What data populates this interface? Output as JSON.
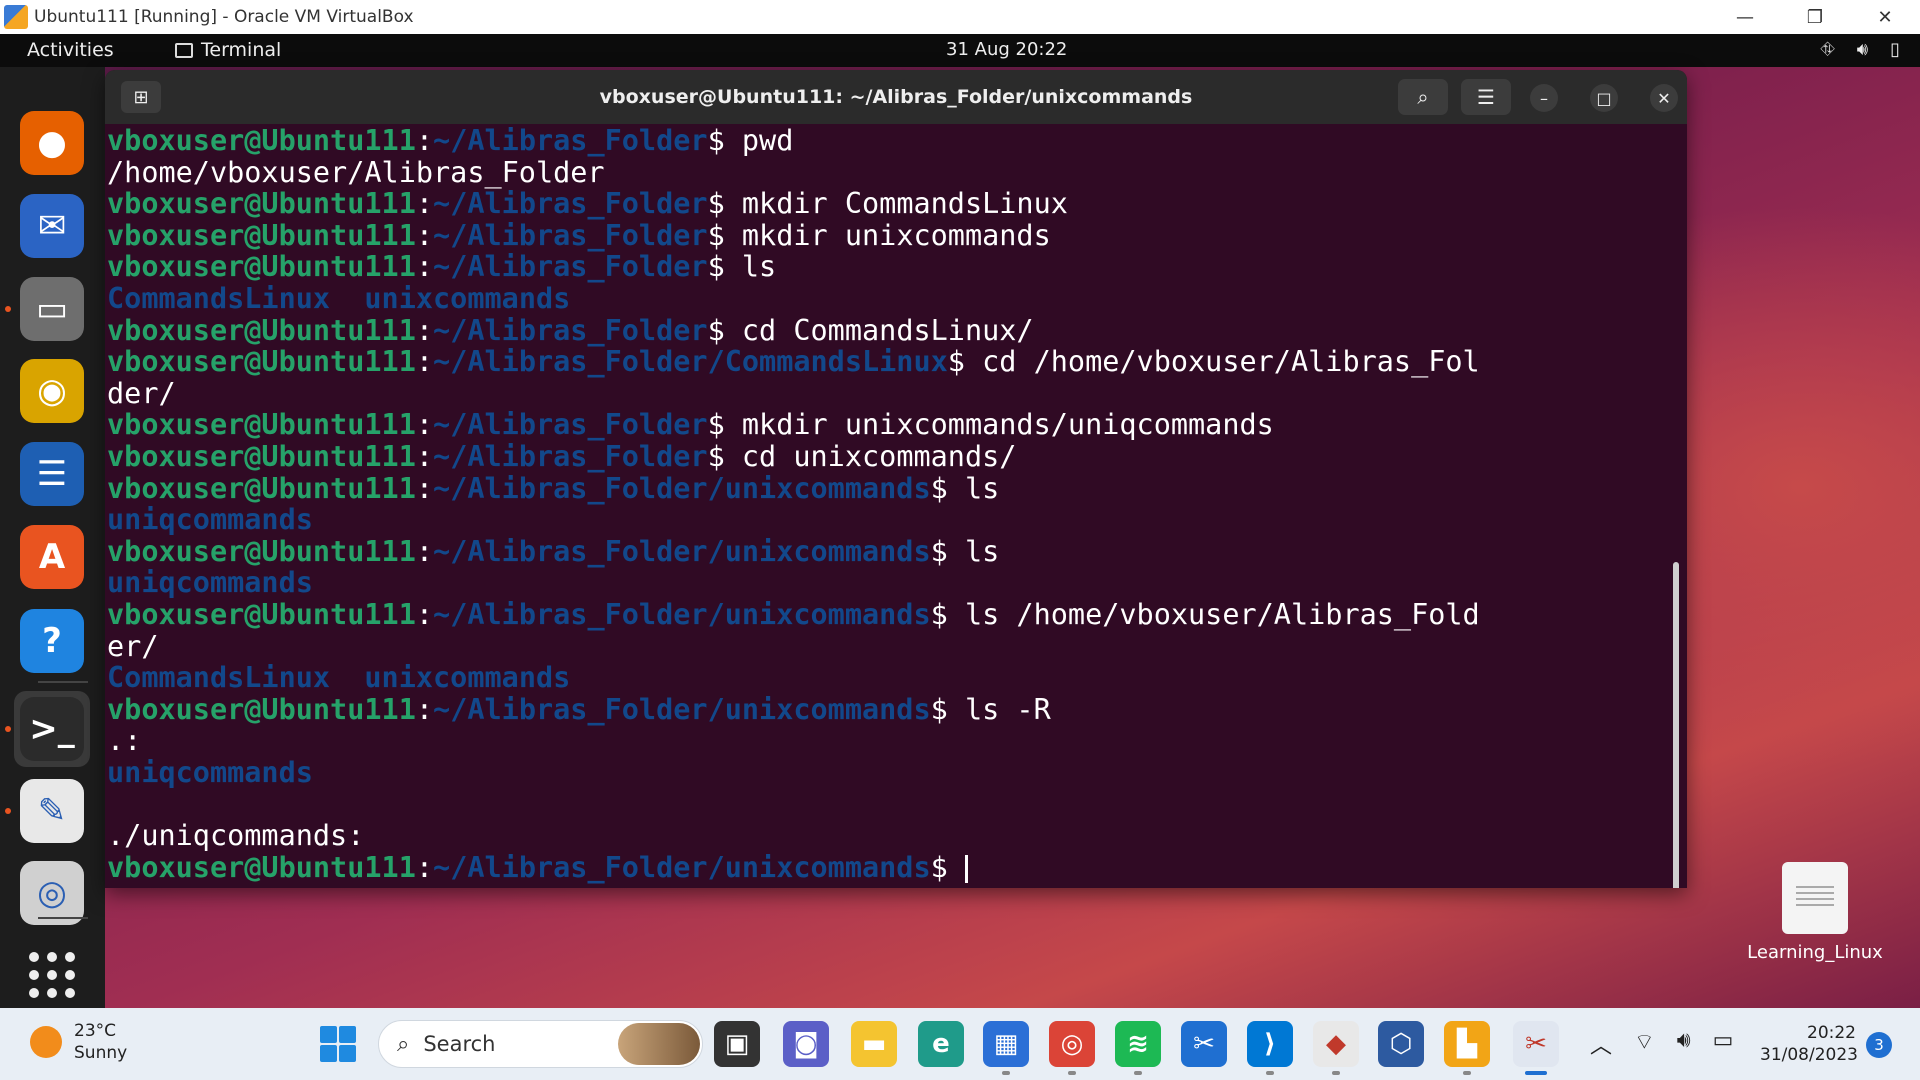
{
  "host_window": {
    "title": "Ubuntu111 [Running] - Oracle VM VirtualBox",
    "controls": [
      "—",
      "❐",
      "✕"
    ]
  },
  "top_bar": {
    "activities": "Activities",
    "app_name": "Terminal",
    "clock": "31 Aug  20:22",
    "status_icons": [
      "network-icon",
      "volume-icon",
      "battery-icon"
    ]
  },
  "dock": {
    "items": [
      {
        "name": "firefox",
        "icon": "firefox-icon",
        "color": "#e66000",
        "glyph": "●",
        "running": false
      },
      {
        "name": "thunderbird",
        "icon": "thunderbird-icon",
        "color": "#2b64c4",
        "glyph": "✉",
        "running": false
      },
      {
        "name": "files",
        "icon": "files-icon",
        "color": "#6e6e6e",
        "glyph": "▭",
        "running": true
      },
      {
        "name": "rhythmbox",
        "icon": "rhythmbox-icon",
        "color": "#d9a400",
        "glyph": "◉",
        "running": false
      },
      {
        "name": "libreoffice-writer",
        "icon": "writer-icon",
        "color": "#1e5fb3",
        "glyph": "☰",
        "running": false
      },
      {
        "name": "app-center",
        "icon": "app-center-icon",
        "color": "#e95420",
        "glyph": "A",
        "running": false
      },
      {
        "name": "help",
        "icon": "help-icon",
        "color": "#1f84e0",
        "glyph": "?",
        "running": false
      },
      {
        "name": "terminal",
        "icon": "terminal-icon",
        "color": "#2b2b2b",
        "glyph": ">_",
        "running": true
      },
      {
        "name": "text-editor",
        "icon": "text-editor-icon",
        "color": "#e8e8e8",
        "glyph": "✎",
        "running": true
      },
      {
        "name": "disc",
        "icon": "disc-icon",
        "color": "#d0d0d0",
        "glyph": "◎",
        "running": false
      }
    ],
    "show_apps_icon": "grid-icon"
  },
  "terminal": {
    "title": "vboxuser@Ubuntu111: ~/Alibras_Folder/unixcommands",
    "lines": [
      [
        {
          "t": "vboxuser@Ubuntu111",
          "c": "u"
        },
        {
          "t": ":",
          "c": ""
        },
        {
          "t": "~/Alibras_Folder",
          "c": "p"
        },
        {
          "t": "$ pwd",
          "c": ""
        }
      ],
      [
        {
          "t": "/home/vboxuser/Alibras_Folder",
          "c": ""
        }
      ],
      [
        {
          "t": "vboxuser@Ubuntu111",
          "c": "u"
        },
        {
          "t": ":",
          "c": ""
        },
        {
          "t": "~/Alibras_Folder",
          "c": "p"
        },
        {
          "t": "$ mkdir CommandsLinux",
          "c": ""
        }
      ],
      [
        {
          "t": "vboxuser@Ubuntu111",
          "c": "u"
        },
        {
          "t": ":",
          "c": ""
        },
        {
          "t": "~/Alibras_Folder",
          "c": "p"
        },
        {
          "t": "$ mkdir unixcommands",
          "c": ""
        }
      ],
      [
        {
          "t": "vboxuser@Ubuntu111",
          "c": "u"
        },
        {
          "t": ":",
          "c": ""
        },
        {
          "t": "~/Alibras_Folder",
          "c": "p"
        },
        {
          "t": "$ ls",
          "c": ""
        }
      ],
      [
        {
          "t": "CommandsLinux",
          "c": "d"
        },
        {
          "t": "  ",
          "c": ""
        },
        {
          "t": "unixcommands",
          "c": "d"
        }
      ],
      [
        {
          "t": "vboxuser@Ubuntu111",
          "c": "u"
        },
        {
          "t": ":",
          "c": ""
        },
        {
          "t": "~/Alibras_Folder",
          "c": "p"
        },
        {
          "t": "$ cd CommandsLinux/",
          "c": ""
        }
      ],
      [
        {
          "t": "vboxuser@Ubuntu111",
          "c": "u"
        },
        {
          "t": ":",
          "c": ""
        },
        {
          "t": "~/Alibras_Folder/CommandsLinux",
          "c": "p"
        },
        {
          "t": "$ cd /home/vboxuser/Alibras_Fol",
          "c": ""
        }
      ],
      [
        {
          "t": "der/",
          "c": ""
        }
      ],
      [
        {
          "t": "vboxuser@Ubuntu111",
          "c": "u"
        },
        {
          "t": ":",
          "c": ""
        },
        {
          "t": "~/Alibras_Folder",
          "c": "p"
        },
        {
          "t": "$ mkdir unixcommands/uniqcommands",
          "c": ""
        }
      ],
      [
        {
          "t": "vboxuser@Ubuntu111",
          "c": "u"
        },
        {
          "t": ":",
          "c": ""
        },
        {
          "t": "~/Alibras_Folder",
          "c": "p"
        },
        {
          "t": "$ cd unixcommands/",
          "c": ""
        }
      ],
      [
        {
          "t": "vboxuser@Ubuntu111",
          "c": "u"
        },
        {
          "t": ":",
          "c": ""
        },
        {
          "t": "~/Alibras_Folder/unixcommands",
          "c": "p"
        },
        {
          "t": "$ ls",
          "c": ""
        }
      ],
      [
        {
          "t": "uniqcommands",
          "c": "d"
        }
      ],
      [
        {
          "t": "vboxuser@Ubuntu111",
          "c": "u"
        },
        {
          "t": ":",
          "c": ""
        },
        {
          "t": "~/Alibras_Folder/unixcommands",
          "c": "p"
        },
        {
          "t": "$ ls",
          "c": ""
        }
      ],
      [
        {
          "t": "uniqcommands",
          "c": "d"
        }
      ],
      [
        {
          "t": "vboxuser@Ubuntu111",
          "c": "u"
        },
        {
          "t": ":",
          "c": ""
        },
        {
          "t": "~/Alibras_Folder/unixcommands",
          "c": "p"
        },
        {
          "t": "$ ls /home/vboxuser/Alibras_Fold",
          "c": ""
        }
      ],
      [
        {
          "t": "er/",
          "c": ""
        }
      ],
      [
        {
          "t": "CommandsLinux",
          "c": "d"
        },
        {
          "t": "  ",
          "c": ""
        },
        {
          "t": "unixcommands",
          "c": "d"
        }
      ],
      [
        {
          "t": "vboxuser@Ubuntu111",
          "c": "u"
        },
        {
          "t": ":",
          "c": ""
        },
        {
          "t": "~/Alibras_Folder/unixcommands",
          "c": "p"
        },
        {
          "t": "$ ls -R",
          "c": ""
        }
      ],
      [
        {
          "t": ".:",
          "c": ""
        }
      ],
      [
        {
          "t": "uniqcommands",
          "c": "d"
        }
      ],
      [
        {
          "t": "",
          "c": ""
        }
      ],
      [
        {
          "t": "./uniqcommands:",
          "c": ""
        }
      ],
      [
        {
          "t": "vboxuser@Ubuntu111",
          "c": "u"
        },
        {
          "t": ":",
          "c": ""
        },
        {
          "t": "~/Alibras_Folder/unixcommands",
          "c": "p"
        },
        {
          "t": "$ ",
          "c": ""
        }
      ]
    ]
  },
  "desktop": {
    "file_label": "Learning_Linux"
  },
  "taskbar": {
    "weather_temp": "23°C",
    "weather_desc": "Sunny",
    "search_placeholder": "Search",
    "time": "20:22",
    "date": "31/08/2023",
    "notification_count": "3",
    "apps": [
      {
        "name": "task-view",
        "icon": "task-view-icon",
        "color": "#333333",
        "glyph": "▣"
      },
      {
        "name": "teams",
        "icon": "teams-chat-icon",
        "color": "#5b5fc7",
        "glyph": "◙"
      },
      {
        "name": "file-explorer",
        "icon": "folder-icon",
        "color": "#f4c430",
        "glyph": "▬"
      },
      {
        "name": "edge",
        "icon": "edge-icon",
        "color": "#1f9b8a",
        "glyph": "e"
      },
      {
        "name": "store",
        "icon": "store-icon",
        "color": "#2b6fd6",
        "glyph": "▦"
      },
      {
        "name": "chrome",
        "icon": "chrome-icon",
        "color": "#db4437",
        "glyph": "◎"
      },
      {
        "name": "spotify",
        "icon": "spotify-icon",
        "color": "#1db954",
        "glyph": "≋"
      },
      {
        "name": "snip",
        "icon": "snip-icon",
        "color": "#1f6fd1",
        "glyph": "✂"
      },
      {
        "name": "vscode",
        "icon": "vscode-icon",
        "color": "#0078d4",
        "glyph": "⟩"
      },
      {
        "name": "git",
        "icon": "git-icon",
        "color": "#e8e8e8",
        "glyph": "◆"
      },
      {
        "name": "virtualbox",
        "icon": "virtualbox-icon",
        "color": "#2d5aa0",
        "glyph": "⬡"
      },
      {
        "name": "vbox-vm",
        "icon": "vbox-vm-icon",
        "color": "#f2a516",
        "glyph": "▙"
      },
      {
        "name": "snipping-tool",
        "icon": "snipping-tool-icon",
        "color": "#e0e6f0",
        "glyph": "✂"
      }
    ]
  }
}
